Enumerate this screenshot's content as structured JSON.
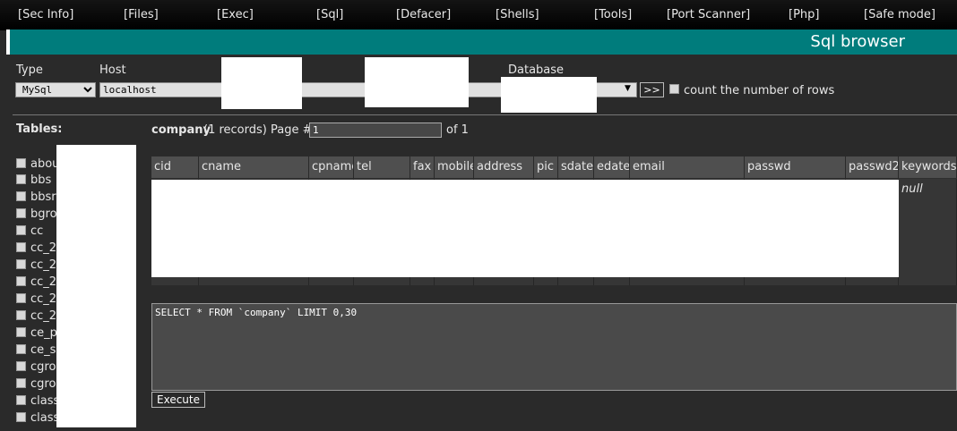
{
  "menu": {
    "items": [
      "[Sec Info]",
      "[Files]",
      "[Exec]",
      "[Sql]",
      "[Defacer]",
      "[Shells]",
      "[Tools]",
      "[Port Scanner]",
      "[Php]",
      "[Safe mode]"
    ]
  },
  "header": {
    "title": "Sql browser"
  },
  "connection": {
    "type_label": "Type",
    "type_value": "MySql",
    "host_label": "Host",
    "host_value": "localhost",
    "database_label": "Database",
    "go_label": ">>",
    "count_rows_label": "count the number of rows"
  },
  "tables_panel": {
    "title": "Tables:",
    "items": [
      "abou",
      "bbs",
      "bbsr",
      "bgro",
      "cc",
      "cc_2",
      "cc_2",
      "cc_2",
      "cc_2",
      "cc_2",
      "ce_p",
      "ce_s",
      "cgro",
      "cgro",
      "class",
      "class"
    ]
  },
  "table_view": {
    "table_name": "company",
    "records_text": "(1 records) Page #",
    "page_value": "1",
    "of_text": "of 1",
    "columns": [
      "cid",
      "cname",
      "cpname",
      "tel",
      "fax",
      "mobile",
      "address",
      "pic",
      "sdate",
      "edate",
      "email",
      "passwd",
      "passwd2",
      "keywords"
    ],
    "null_value": "null"
  },
  "query": {
    "sql": "SELECT * FROM `company` LIMIT 0,30",
    "execute_label": "Execute"
  },
  "colors": {
    "header_bg": "#007c7c",
    "page_bg": "#2a2a2a",
    "menu_bg": "#000000"
  }
}
